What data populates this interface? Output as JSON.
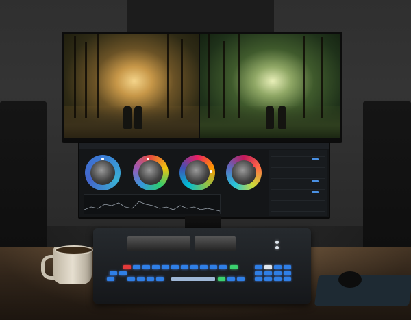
{
  "scene": {
    "subject": "color-grading-desk",
    "icons": [
      "coffee-mug-icon",
      "monitor-icon",
      "console-icon",
      "mouse-icon"
    ]
  },
  "app": {
    "title": "",
    "menu": ""
  },
  "panel": {
    "rows": [
      "",
      "",
      "",
      "",
      "",
      "",
      "",
      "",
      "",
      "",
      ""
    ]
  },
  "colors": {
    "warm_photo": "#c79748",
    "graded_photo": "#8fa765",
    "key_blue": "#2f7fe6",
    "key_red": "#e33a3a",
    "key_green": "#3bd16f"
  }
}
